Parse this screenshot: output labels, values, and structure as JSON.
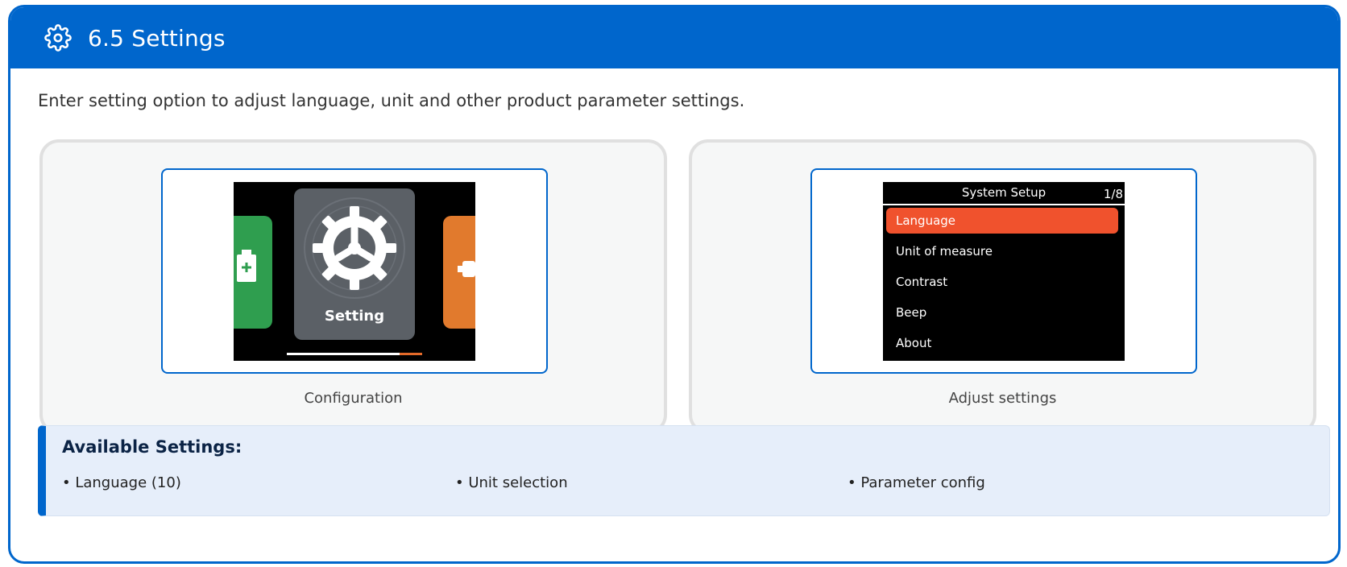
{
  "header": {
    "title": "6.5 Settings",
    "icon": "gear-icon"
  },
  "intro": "Enter setting option to adjust language, unit and other product parameter settings.",
  "cards": [
    {
      "caption": "Configuration",
      "screen": {
        "tile_label": "Setting"
      }
    },
    {
      "caption": "Adjust settings",
      "screen": {
        "title": "System Setup",
        "page": "1/8",
        "items": [
          "Language",
          "Unit of measure",
          "Contrast",
          "Beep",
          "About"
        ],
        "selected_index": 0
      }
    }
  ],
  "info": {
    "title": "Available Settings:",
    "items": [
      "• Language (10)",
      "• Unit selection",
      "• Parameter config"
    ]
  },
  "colors": {
    "primary": "#0066cc",
    "highlight": "#f0522d",
    "tile_green": "#2f9e4f",
    "tile_orange": "#e17a2d"
  }
}
